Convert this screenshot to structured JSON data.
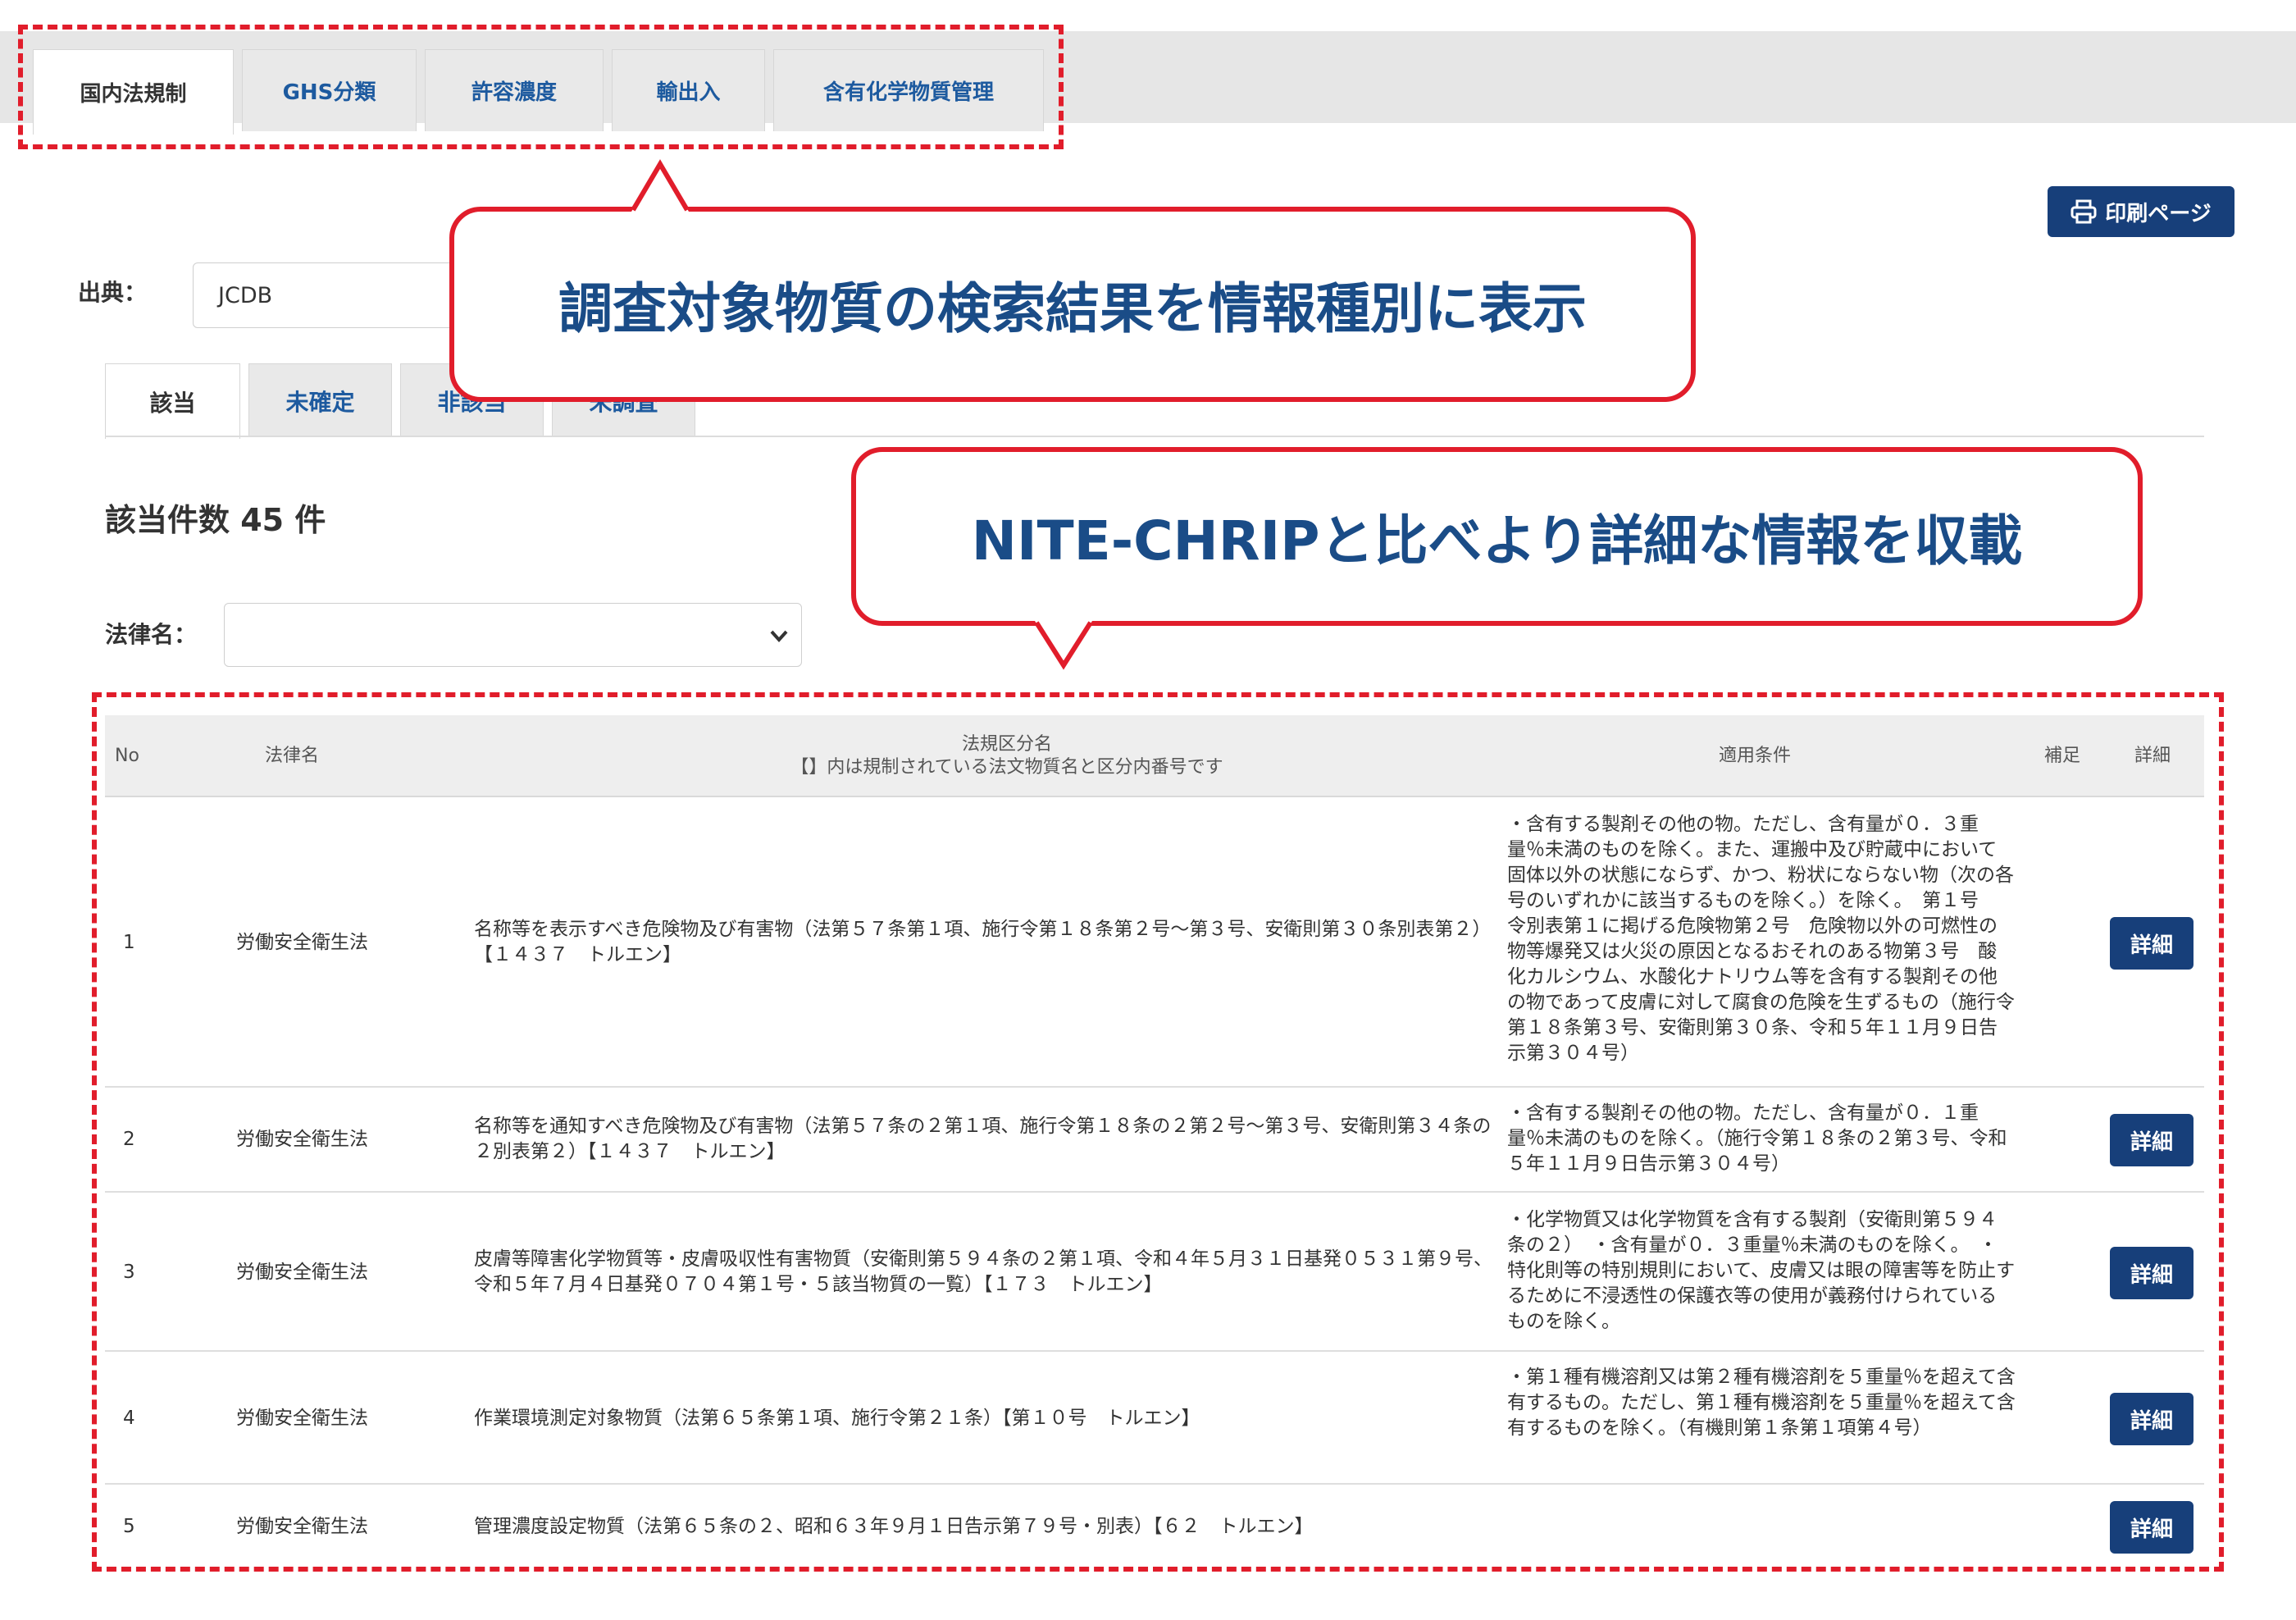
{
  "top_tabs": [
    "国内法規制",
    "GHS分類",
    "許容濃度",
    "輸出入",
    "含有化学物質管理"
  ],
  "print_button": "印刷ページ",
  "callouts": [
    "調査対象物質の検索結果を情報種別に表示",
    "NITE-CHRIPと比べより詳細な情報を収載"
  ],
  "source_label": "出典：",
  "source_value": "JCDB",
  "sub_tabs": [
    "該当",
    "未確定",
    "非該当",
    "未調査"
  ],
  "result_count": "該当件数 45 件",
  "law_filter_label": "法律名：",
  "table": {
    "headers": {
      "no": "No",
      "law": "法律名",
      "category": "法規区分名",
      "category_note": "【】内は規制されている法文物質名と区分内番号です",
      "conditions": "適用条件",
      "supplement": "補足",
      "detail": "詳細"
    },
    "detail_label": "詳細",
    "rows": [
      {
        "no": "1",
        "law": "労働安全衛生法",
        "category": "名称等を表示すべき危険物及び有害物（法第５７条第１項、施行令第１８条第２号〜第３号、安衛則第３０条別表第２）【１４３７　トルエン】",
        "conditions": "・含有する製剤その他の物。ただし、含有量が０．３重量％未満のものを除く。また、運搬中及び貯蔵中において固体以外の状態にならず、かつ、粉状にならない物（次の各号のいずれかに該当するものを除く。）を除く。　第１号　令別表第１に掲げる危険物第２号　危険物以外の可燃性の物等爆発又は火災の原因となるおそれのある物第３号　酸化カルシウム、水酸化ナトリウム等を含有する製剤その他の物であって皮膚に対して腐食の危険を生ずるもの（施行令第１８条第３号、安衛則第３０条、令和５年１１月９日告示第３０４号）"
      },
      {
        "no": "2",
        "law": "労働安全衛生法",
        "category": "名称等を通知すべき危険物及び有害物（法第５７条の２第１項、施行令第１８条の２第２号〜第３号、安衛則第３４条の２別表第２）【１４３７　トルエン】",
        "conditions": "・含有する製剤その他の物。ただし、含有量が０．１重量％未満のものを除く。（施行令第１８条の２第３号、令和５年１１月９日告示第３０４号）"
      },
      {
        "no": "3",
        "law": "労働安全衛生法",
        "category": "皮膚等障害化学物質等・皮膚吸収性有害物質（安衛則第５９４条の２第１項、令和４年５月３１日基発０５３１第９号、令和５年７月４日基発０７０４第１号・５該当物質の一覧）【１７３　トルエン】",
        "conditions": "・化学物質又は化学物質を含有する製剤（安衛則第５９４条の２）　・含有量が０．３重量％未満のものを除く。　・特化則等の特別規則において、皮膚又は眼の障害等を防止するために不浸透性の保護衣等の使用が義務付けられているものを除く。"
      },
      {
        "no": "4",
        "law": "労働安全衛生法",
        "category": "作業環境測定対象物質（法第６５条第１項、施行令第２１条）【第１０号　トルエン】",
        "conditions": "・第１種有機溶剤又は第２種有機溶剤を５重量％を超えて含有するもの。ただし、第１種有機溶剤を５重量％を超えて含有するものを除く。（有機則第１条第１項第４号）"
      },
      {
        "no": "5",
        "law": "労働安全衛生法",
        "category": "管理濃度設定物質（法第６５条の２、昭和６３年９月１日告示第７９号・別表）【６２　トルエン】",
        "conditions": ""
      }
    ]
  },
  "colors": {
    "accent_red": "#e11d2b",
    "navy_button": "#173f7a",
    "link_blue": "#1d5a9f",
    "callout_text": "#1a4c87"
  }
}
